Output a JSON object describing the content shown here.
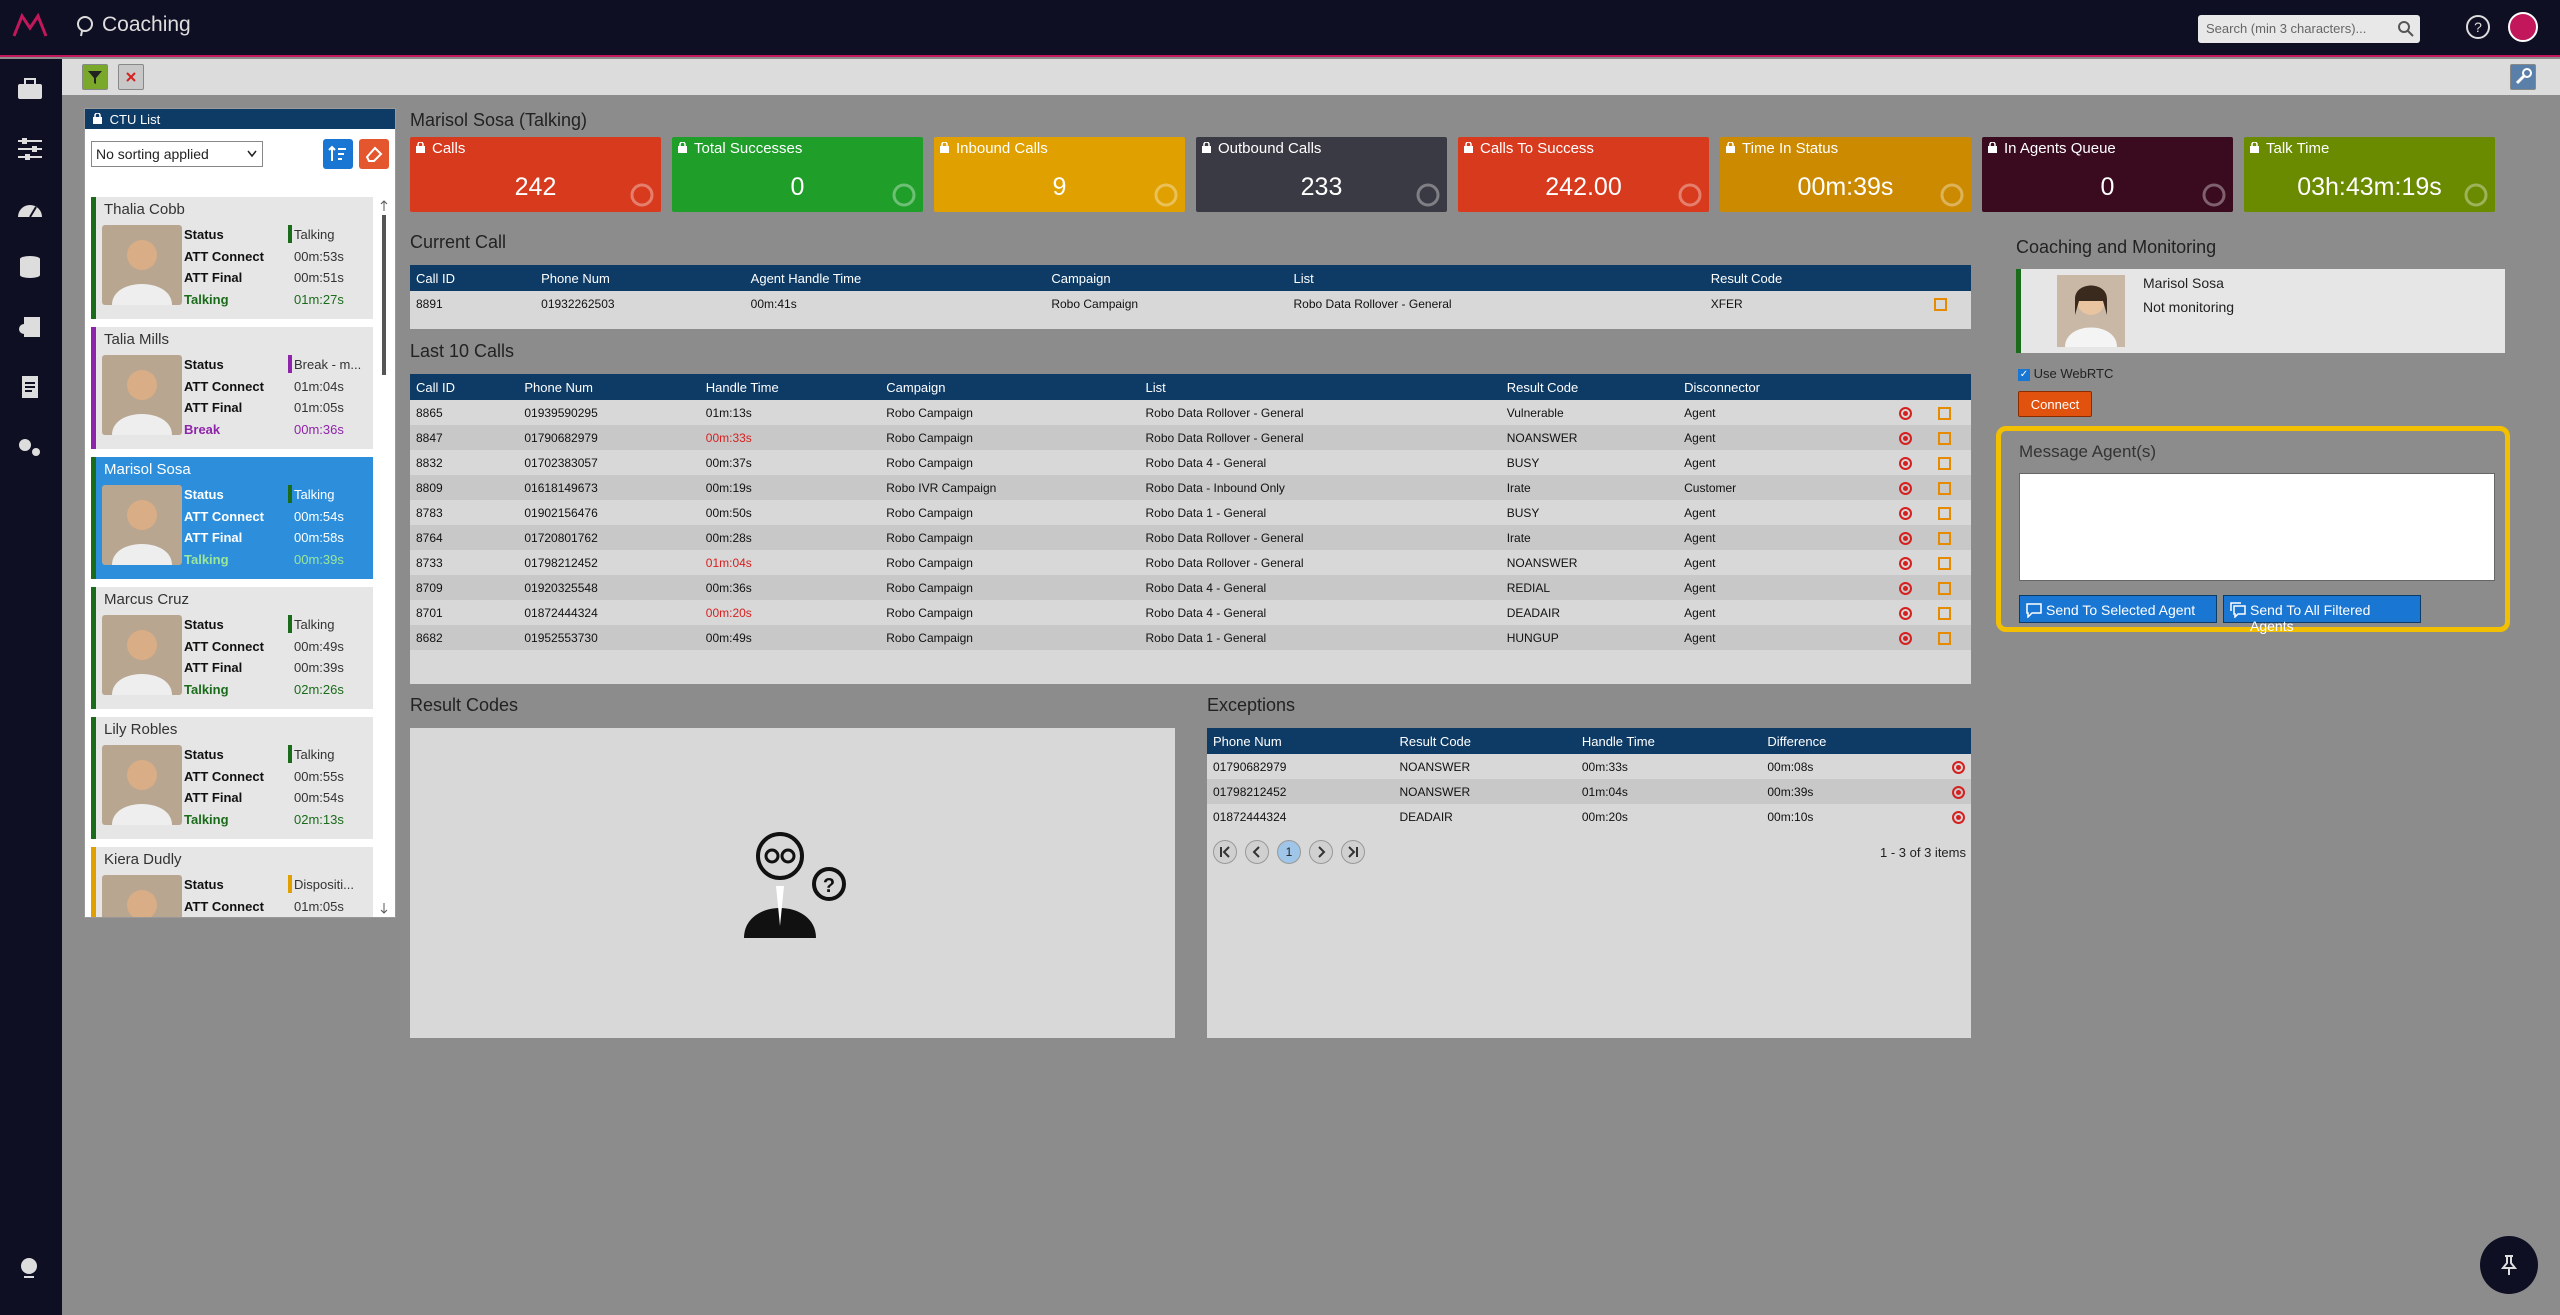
{
  "app": {
    "title": "Coaching",
    "search_placeholder": "Search (min 3 characters)..."
  },
  "ctu": {
    "title": "CTU List",
    "sort_value": "No sorting applied",
    "agents": [
      {
        "name": "Thalia Cobb",
        "status": "Talking",
        "att_connect": "00m:53s",
        "att_final": "00m:51s",
        "state": "Talking",
        "state_time": "01m:27s",
        "color": "#1a6b1a"
      },
      {
        "name": "Talia Mills",
        "status": "Break - m...",
        "att_connect": "01m:04s",
        "att_final": "01m:05s",
        "state": "Break",
        "state_time": "00m:36s",
        "color": "#8e24aa"
      },
      {
        "name": "Marisol Sosa",
        "status": "Talking",
        "att_connect": "00m:54s",
        "att_final": "00m:58s",
        "state": "Talking",
        "state_time": "00m:39s",
        "color": "#1a6b1a"
      },
      {
        "name": "Marcus Cruz",
        "status": "Talking",
        "att_connect": "00m:49s",
        "att_final": "00m:39s",
        "state": "Talking",
        "state_time": "02m:26s",
        "color": "#1a6b1a"
      },
      {
        "name": "Lily Robles",
        "status": "Talking",
        "att_connect": "00m:55s",
        "att_final": "00m:54s",
        "state": "Talking",
        "state_time": "02m:13s",
        "color": "#1a6b1a"
      },
      {
        "name": "Kiera Dudly",
        "status": "Dispositi...",
        "att_connect": "01m:05s",
        "att_final": "",
        "state": "",
        "state_time": "",
        "color": "#e0a000"
      }
    ],
    "labels": {
      "status": "Status",
      "att_connect": "ATT Connect",
      "att_final": "ATT Final"
    }
  },
  "main": {
    "title": "Marisol Sosa (Talking)",
    "stats": [
      {
        "label": "Calls",
        "value": "242",
        "color": "#d83a1e"
      },
      {
        "label": "Total Successes",
        "value": "0",
        "color": "#1f9e2a"
      },
      {
        "label": "Inbound Calls",
        "value": "9",
        "color": "#e0a000"
      },
      {
        "label": "Outbound Calls",
        "value": "233",
        "color": "#3a3a44"
      },
      {
        "label": "Calls To Success",
        "value": "242.00",
        "color": "#d83a1e"
      },
      {
        "label": "Time In Status",
        "value": "00m:39s",
        "color": "#cc8a00"
      },
      {
        "label": "In Agents Queue",
        "value": "0",
        "color": "#3a0a1e"
      },
      {
        "label": "Talk Time",
        "value": "03h:43m:19s",
        "color": "#6a8a00"
      }
    ],
    "current_call": {
      "title": "Current Call",
      "headers": [
        "Call ID",
        "Phone Num",
        "Agent Handle Time",
        "Campaign",
        "List",
        "Result Code"
      ],
      "row": [
        "8891",
        "01932262503",
        "00m:41s",
        "Robo Campaign",
        "Robo Data Rollover - General",
        "XFER"
      ]
    },
    "last_calls": {
      "title": "Last 10 Calls",
      "headers": [
        "Call ID",
        "Phone Num",
        "Handle Time",
        "Campaign",
        "List",
        "Result Code",
        "Disconnector"
      ],
      "rows": [
        [
          "8865",
          "01939590295",
          "01m:13s",
          "Robo Campaign",
          "Robo Data Rollover - General",
          "Vulnerable",
          "Agent"
        ],
        [
          "8847",
          "01790682979",
          "00m:33s",
          "Robo Campaign",
          "Robo Data Rollover - General",
          "NOANSWER",
          "Agent"
        ],
        [
          "8832",
          "01702383057",
          "00m:37s",
          "Robo Campaign",
          "Robo Data 4 - General",
          "BUSY",
          "Agent"
        ],
        [
          "8809",
          "01618149673",
          "00m:19s",
          "Robo IVR Campaign",
          "Robo Data - Inbound Only",
          "Irate",
          "Customer"
        ],
        [
          "8783",
          "01902156476",
          "00m:50s",
          "Robo Campaign",
          "Robo Data 1 - General",
          "BUSY",
          "Agent"
        ],
        [
          "8764",
          "01720801762",
          "00m:28s",
          "Robo Campaign",
          "Robo Data Rollover - General",
          "Irate",
          "Agent"
        ],
        [
          "8733",
          "01798212452",
          "01m:04s",
          "Robo Campaign",
          "Robo Data Rollover - General",
          "NOANSWER",
          "Agent"
        ],
        [
          "8709",
          "01920325548",
          "00m:36s",
          "Robo Campaign",
          "Robo Data 4 - General",
          "REDIAL",
          "Agent"
        ],
        [
          "8701",
          "01872444324",
          "00m:20s",
          "Robo Campaign",
          "Robo Data 4 - General",
          "DEADAIR",
          "Agent"
        ],
        [
          "8682",
          "01952553730",
          "00m:49s",
          "Robo Campaign",
          "Robo Data 1 - General",
          "HUNGUP",
          "Agent"
        ]
      ],
      "red_rows": [
        1,
        6,
        8
      ]
    },
    "result_codes": {
      "title": "Result Codes"
    },
    "exceptions": {
      "title": "Exceptions",
      "headers": [
        "Phone Num",
        "Result Code",
        "Handle Time",
        "Difference"
      ],
      "rows": [
        [
          "01790682979",
          "NOANSWER",
          "00m:33s",
          "00m:08s"
        ],
        [
          "01798212452",
          "NOANSWER",
          "01m:04s",
          "00m:39s"
        ],
        [
          "01872444324",
          "DEADAIR",
          "00m:20s",
          "00m:10s"
        ]
      ],
      "page": "1",
      "summary": "1 - 3 of 3 items"
    }
  },
  "coaching": {
    "title": "Coaching and Monitoring",
    "agent_name": "Marisol Sosa",
    "monitor_status": "Not monitoring",
    "webrtc_label": "Use WebRTC",
    "connect_label": "Connect",
    "message_title": "Message Agent(s)",
    "send_selected": "Send To Selected Agent",
    "send_all": "Send To All Filtered Agents"
  }
}
